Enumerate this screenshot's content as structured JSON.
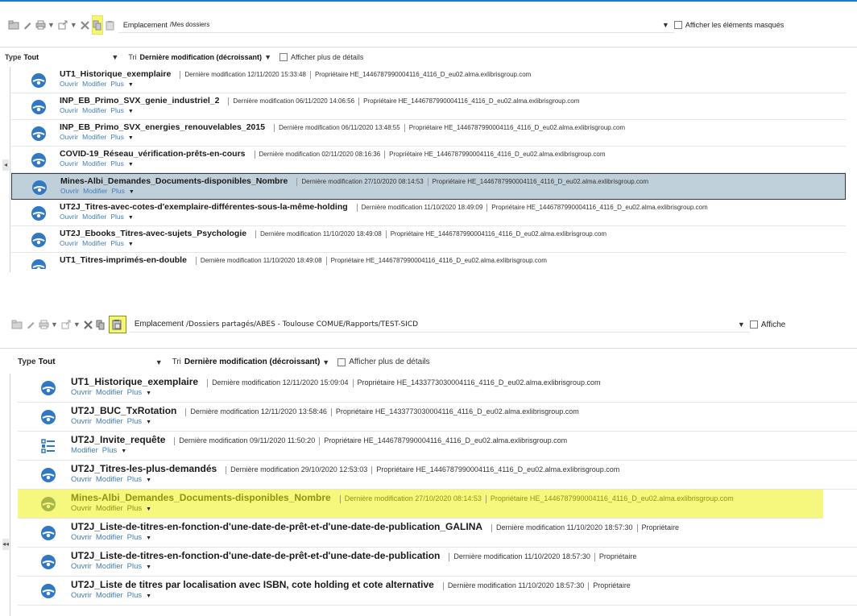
{
  "panels": [
    {
      "toolbar": {
        "emplacement_label": "Emplacement",
        "emplacement_path": "/Mes dossiers",
        "show_hidden_label": "Afficher les éléments masqués"
      },
      "filter": {
        "type_label": "Type",
        "type_value": "Tout",
        "sort_label": "Tri",
        "sort_value": "Dernière modification (décroissant)",
        "details_label": "Afficher plus de détails"
      },
      "items": [
        {
          "title": "UT1_Historique_exemplaire",
          "modified_label": "Dernière modification",
          "modified": "12/11/2020 15:33:48",
          "owner_label": "Propriétaire",
          "owner": "HE_1446787990004116_4116_D_eu02.alma.exlibrisgroup.com",
          "open": "Ouvrir",
          "edit": "Modifier",
          "more": "Plus",
          "icon": "analysis-icon"
        },
        {
          "title": "INP_EB_Primo_SVX_genie_industriel_2",
          "modified_label": "Dernière modification",
          "modified": "06/11/2020 14:06:56",
          "owner_label": "Propriétaire",
          "owner": "HE_1446787990004116_4116_D_eu02.alma.exlibrisgroup.com",
          "open": "Ouvrir",
          "edit": "Modifier",
          "more": "Plus",
          "icon": "analysis-icon"
        },
        {
          "title": "INP_EB_Primo_SVX_energies_renouvelables_2015",
          "modified_label": "Dernière modification",
          "modified": "06/11/2020 13:48:55",
          "owner_label": "Propriétaire",
          "owner": "HE_1446787990004116_4116_D_eu02.alma.exlibrisgroup.com",
          "open": "Ouvrir",
          "edit": "Modifier",
          "more": "Plus",
          "icon": "analysis-icon"
        },
        {
          "title": "COVID-19_Réseau_vérification-prêts-en-cours",
          "modified_label": "Dernière modification",
          "modified": "02/11/2020 08:16:36",
          "owner_label": "Propriétaire",
          "owner": "HE_1446787990004116_4116_D_eu02.alma.exlibrisgroup.com",
          "open": "Ouvrir",
          "edit": "Modifier",
          "more": "Plus",
          "icon": "analysis-icon"
        },
        {
          "title": "Mines-Albi_Demandes_Documents-disponibles_Nombre",
          "modified_label": "Dernière modification",
          "modified": "27/10/2020 08:14:53",
          "owner_label": "Propriétaire",
          "owner": "HE_1446787990004116_4116_D_eu02.alma.exlibrisgroup.com",
          "open": "Ouvrir",
          "edit": "Modifier",
          "more": "Plus",
          "icon": "analysis-icon",
          "state": "selected"
        },
        {
          "title": "UT2J_Titres-avec-cotes-d'exemplaire-différentes-sous-la-même-holding",
          "modified_label": "Dernière modification",
          "modified": "11/10/2020 18:49:09",
          "owner_label": "Propriétaire",
          "owner": "HE_1446787990004116_4116_D_eu02.alma.exlibrisgroup.com",
          "open": "Ouvrir",
          "edit": "Modifier",
          "more": "Plus",
          "icon": "analysis-icon"
        },
        {
          "title": "UT2J_Ebooks_Titres-avec-sujets_Psychologie",
          "modified_label": "Dernière modification",
          "modified": "11/10/2020 18:49:08",
          "owner_label": "Propriétaire",
          "owner": "HE_1446787990004116_4116_D_eu02.alma.exlibrisgroup.com",
          "open": "Ouvrir",
          "edit": "Modifier",
          "more": "Plus",
          "icon": "analysis-icon"
        },
        {
          "title": "UT1_Titres-imprimés-en-double",
          "modified_label": "Dernière modification",
          "modified": "11/10/2020 18:49:08",
          "owner_label": "Propriétaire",
          "owner": "HE_1446787990004116_4116_D_eu02.alma.exlibrisgroup.com",
          "open": "",
          "edit": "",
          "more": "",
          "icon": "analysis-icon",
          "state": "cut"
        }
      ]
    },
    {
      "toolbar": {
        "emplacement_label": "Emplacement",
        "emplacement_path": "/Dossiers partagés/ABES - Toulouse COMUE/Rapports/TEST-SICD",
        "show_hidden_label": "Affiche"
      },
      "filter": {
        "type_label": "Type",
        "type_value": "Tout",
        "sort_label": "Tri",
        "sort_value": "Dernière modification (décroissant)",
        "details_label": "Afficher plus de détails"
      },
      "items": [
        {
          "title": "UT1_Historique_exemplaire",
          "modified_label": "Dernière modification",
          "modified": "12/11/2020 15:09:04",
          "owner_label": "Propriétaire",
          "owner": "HE_1433773030004116_4116_D_eu02.alma.exlibrisgroup.com",
          "open": "Ouvrir",
          "edit": "Modifier",
          "more": "Plus",
          "icon": "analysis-icon"
        },
        {
          "title": "UT2J_BUC_TxRotation",
          "modified_label": "Dernière modification",
          "modified": "12/11/2020 13:58:46",
          "owner_label": "Propriétaire",
          "owner": "HE_1433773030004116_4116_D_eu02.alma.exlibrisgroup.com",
          "open": "Ouvrir",
          "edit": "Modifier",
          "more": "Plus",
          "icon": "analysis-icon"
        },
        {
          "title": "UT2J_Invite_requête",
          "modified_label": "Dernière modification",
          "modified": "09/11/2020 11:50:20",
          "owner_label": "Propriétaire",
          "owner": "HE_1446787990004116_4116_D_eu02.alma.exlibrisgroup.com",
          "open": "",
          "edit": "Modifier",
          "more": "Plus",
          "icon": "prompt-icon"
        },
        {
          "title": "UT2J_Titres-les-plus-demandés",
          "modified_label": "Dernière modification",
          "modified": "29/10/2020 12:53:03",
          "owner_label": "Propriétaire",
          "owner": "HE_1446787990004116_4116_D_eu02.alma.exlibrisgroup.com",
          "open": "Ouvrir",
          "edit": "Modifier",
          "more": "Plus",
          "icon": "analysis-icon"
        },
        {
          "title": "Mines-Albi_Demandes_Documents-disponibles_Nombre",
          "modified_label": "Dernière modification",
          "modified": "27/10/2020 08:14:53",
          "owner_label": "Propriétaire",
          "owner": "HE_1446787990004116_4116_D_eu02.alma.exlibrisgroup.com",
          "open": "Ouvrir",
          "edit": "Modifier",
          "more": "Plus",
          "icon": "analysis-icon",
          "state": "yellow"
        },
        {
          "title": "UT2J_Liste-de-titres-en-fonction-d'une-date-de-prêt-et-d'une-date-de-publication_GALINA",
          "modified_label": "Dernière modification",
          "modified": "11/10/2020 18:57:30",
          "owner_label": "Propriétaire",
          "owner": "",
          "open": "Ouvrir",
          "edit": "Modifier",
          "more": "Plus",
          "icon": "analysis-icon"
        },
        {
          "title": "UT2J_Liste-de-titres-en-fonction-d'une-date-de-prêt-et-d'une-date-de-publication",
          "modified_label": "Dernière modification",
          "modified": "11/10/2020 18:57:30",
          "owner_label": "Propriétaire",
          "owner": "",
          "open": "Ouvrir",
          "edit": "Modifier",
          "more": "Plus",
          "icon": "analysis-icon"
        },
        {
          "title": "UT2J_Liste de titres par localisation avec ISBN, cote holding et cote alternative",
          "modified_label": "Dernière modification",
          "modified": "11/10/2020 18:57:30",
          "owner_label": "Propriétaire",
          "owner": "",
          "open": "Ouvrir",
          "edit": "Modifier",
          "more": "Plus",
          "icon": "analysis-icon"
        }
      ]
    }
  ],
  "colors": {
    "accent_blue": "#1f77c9",
    "link_blue": "#3f7fb8",
    "selected_row": "#c0d0db",
    "highlight_yellow": "#f5f87c"
  }
}
